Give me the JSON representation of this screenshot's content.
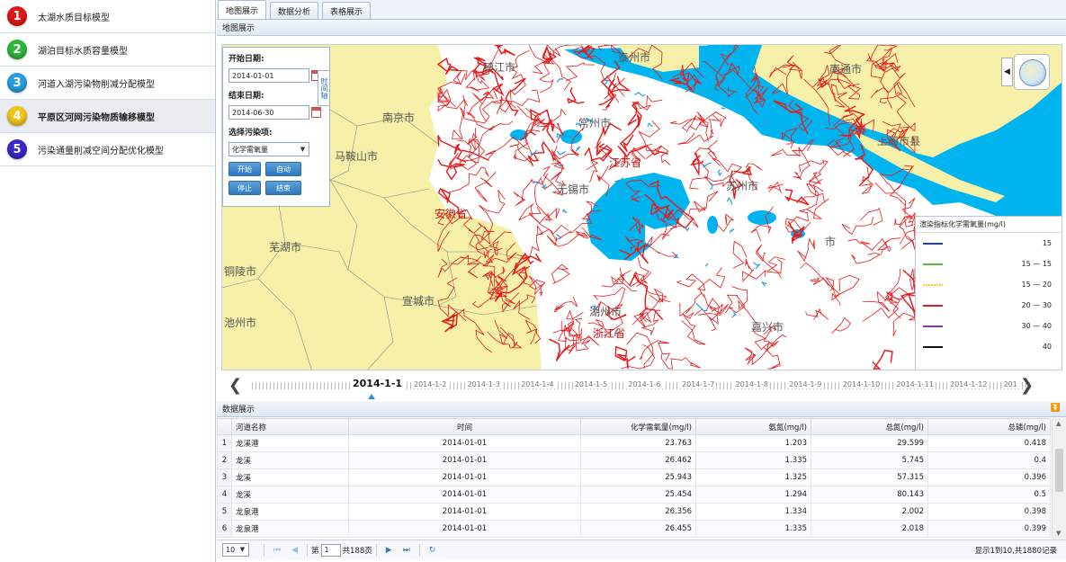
{
  "sidebar": {
    "items": [
      {
        "num": "1",
        "label": "太湖水质目标模型",
        "color": "#e01818"
      },
      {
        "num": "2",
        "label": "湖泊目标水质容量模型",
        "color": "#2fb83a"
      },
      {
        "num": "3",
        "label": "河道入湖污染物削减分配模型",
        "color": "#2a9fe0"
      },
      {
        "num": "4",
        "label": "平原区河网污染物质输移模型",
        "color": "#f2c614"
      },
      {
        "num": "5",
        "label": "污染通量削减空间分配优化模型",
        "color": "#3a28c8"
      }
    ]
  },
  "tabs": [
    "地图展示",
    "数据分析",
    "表格展示"
  ],
  "map_panel_title": "地图展示",
  "controls": {
    "start_label": "开始日期:",
    "start_value": "2014-01-01",
    "end_label": "结束日期:",
    "end_value": "2014-06-30",
    "pollutant_label": "选择污染项:",
    "pollutant_value": "化学需氧量",
    "btn_start": "开始",
    "btn_auto": "自动",
    "btn_stop": "停止",
    "btn_end": "结束",
    "time_axis_tab": "时间轴"
  },
  "map_labels": {
    "zhenjiang": "镇江市",
    "taizhou": "泰州市",
    "nantong": "南通市",
    "nanjing": "南京市",
    "maanshan": "马鞍山市",
    "changzhou": "常州市",
    "jiangsu": "江苏省",
    "wuxi": "无锡市",
    "suzhou": "苏州市",
    "shanghai": "上海市县",
    "anhui": "安徽省",
    "wuhu": "芜湖市",
    "tongling": "铜陵市",
    "xuancheng": "宣城市",
    "chizhou": "池州市",
    "huzhou": "湖州市",
    "zhejiang": "浙江省",
    "jiaxing": "嘉兴市",
    "shi": "市"
  },
  "legend": {
    "title": "渲染指标化学需氧量(mg/l)",
    "rows": [
      {
        "label": "15",
        "color": "#2a3f9a",
        "dashed": false
      },
      {
        "label": "15 — 15",
        "color": "#5abf3c",
        "dashed": false
      },
      {
        "label": "15 — 20",
        "color": "#f0d020",
        "dashed": true
      },
      {
        "label": "20 — 30",
        "color": "#e02020",
        "dashed": false
      },
      {
        "label": "30 — 40",
        "color": "#8a3aa8",
        "dashed": false
      },
      {
        "label": "40",
        "color": "#111111",
        "dashed": false
      }
    ]
  },
  "timeline": {
    "current": "2014-1-1",
    "labels": [
      "2014-1-2",
      "2014-1-3",
      "2014-1-4",
      "2014-1-5",
      "2014-1-6",
      "2014-1-7",
      "2014-1-8",
      "2014-1-9",
      "2014-1-10",
      "2014-1-11",
      "2014-1-12",
      "201"
    ]
  },
  "data_panel_title": "数据展示",
  "table": {
    "headers": [
      "河道名称",
      "时间",
      "化学需氧量(mg/l)",
      "氨氮(mg/l)",
      "总氮(mg/l)",
      "总磷(mg/l)"
    ],
    "rows": [
      [
        "1",
        "龙溪港",
        "2014-01-01",
        "23.763",
        "1.203",
        "29.599",
        "0.418"
      ],
      [
        "2",
        "龙溪",
        "2014-01-01",
        "26.462",
        "1.335",
        "5.745",
        "0.4"
      ],
      [
        "3",
        "龙溪",
        "2014-01-01",
        "25.943",
        "1.325",
        "57.315",
        "0.396"
      ],
      [
        "4",
        "龙溪",
        "2014-01-01",
        "25.454",
        "1.294",
        "80.143",
        "0.5"
      ],
      [
        "5",
        "龙泉港",
        "2014-01-01",
        "26.356",
        "1.334",
        "2.002",
        "0.398"
      ],
      [
        "6",
        "龙泉港",
        "2014-01-01",
        "26.455",
        "1.335",
        "2.018",
        "0.399"
      ]
    ]
  },
  "pager": {
    "page_size": "10",
    "page_prefix": "第",
    "page_value": "1",
    "page_suffix": "共188页",
    "info": "显示1到10,共1880记录"
  }
}
